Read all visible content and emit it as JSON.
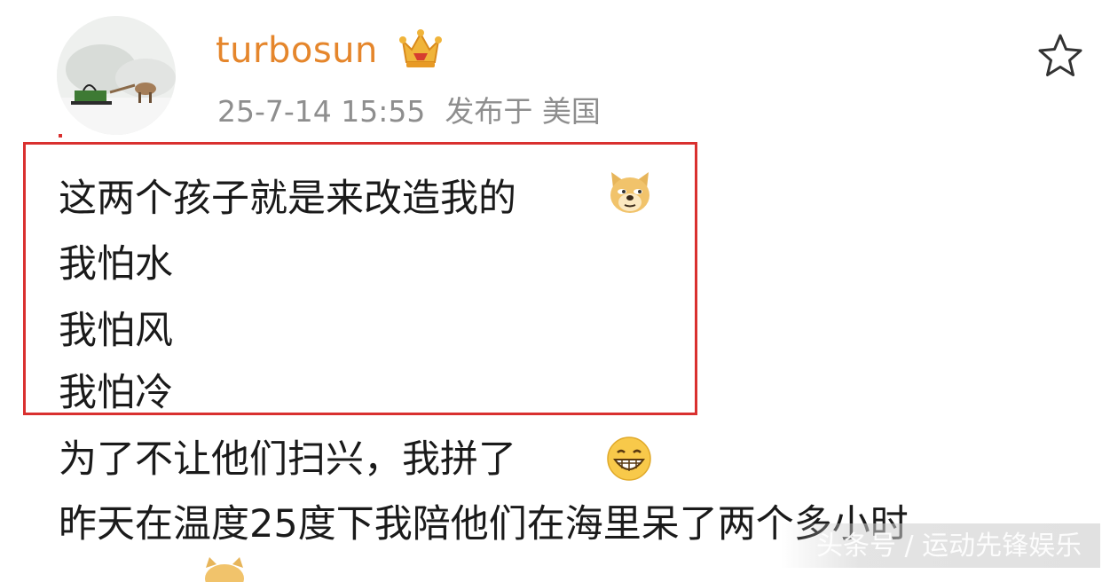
{
  "post": {
    "username": "turbosun",
    "timestamp": "25-7-14 15:55",
    "location": "发布于 美国",
    "lines": [
      "这两个孩子就是来改造我的",
      "我怕水",
      "我怕风",
      "我怕冷",
      "为了不让他们扫兴，我拼了",
      "昨天在温度25度下我陪他们在海里呆了两个多小时"
    ]
  },
  "icons": {
    "avatar": "avatar-image",
    "badge": "crown-icon",
    "favorite": "star-icon",
    "emoji_1": "doge-emoji-icon",
    "emoji_2": "grin-emoji-icon"
  },
  "colors": {
    "username": "#e5862c",
    "highlight_border": "#d9302f",
    "meta_text": "#8e8e8e"
  },
  "watermark": {
    "text": "头条号 / 运动先锋娱乐"
  }
}
